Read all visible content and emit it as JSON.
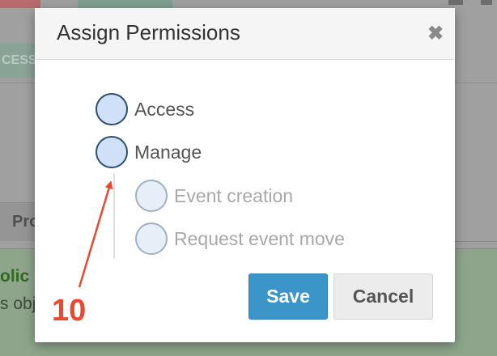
{
  "background": {
    "access_badge": "CESS",
    "tab_label": "Pro",
    "panel_title": "olic",
    "panel_text": "s obj"
  },
  "dialog": {
    "title": "Assign Permissions",
    "close_icon": "close-icon",
    "permissions": {
      "access": {
        "label": "Access",
        "enabled": true
      },
      "manage": {
        "label": "Manage",
        "enabled": true
      },
      "event_creation": {
        "label": "Event creation",
        "enabled": false
      },
      "request_event_move": {
        "label": "Request event move",
        "enabled": false
      }
    },
    "save_label": "Save",
    "cancel_label": "Cancel"
  },
  "annotation": {
    "number": "10",
    "color": "#e8492f"
  },
  "colors": {
    "primary_button": "#3b95c9",
    "radio_fill": "#cfe0f8",
    "radio_border": "#2d4f6d"
  }
}
